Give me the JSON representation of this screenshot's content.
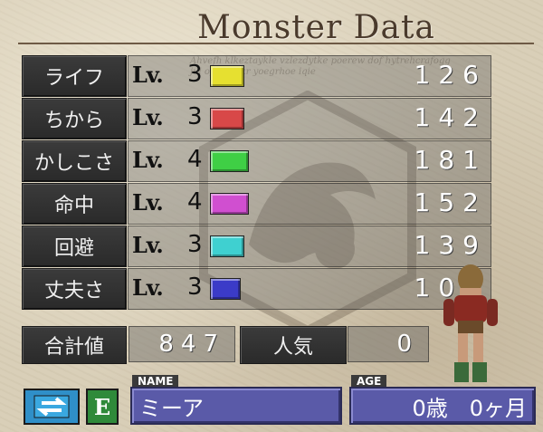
{
  "title": "Monster Data",
  "lv_prefix": "Lv.",
  "stats": [
    {
      "label": "ライフ",
      "level": "3",
      "color": "#e6e030",
      "value": "126",
      "bar_level": 0.33
    },
    {
      "label": "ちから",
      "level": "3",
      "color": "#d84848",
      "value": "142",
      "bar_level": 0.33
    },
    {
      "label": "かしこさ",
      "level": "4",
      "color": "#3fcf45",
      "value": "181",
      "bar_level": 0.5
    },
    {
      "label": "命中",
      "level": "4",
      "color": "#d04fd0",
      "value": "152",
      "bar_level": 0.5
    },
    {
      "label": "回避",
      "level": "3",
      "color": "#3fd0d0",
      "value": "139",
      "bar_level": 0.33
    },
    {
      "label": "丈夫さ",
      "level": "3",
      "color": "#3b3bc8",
      "value": "107",
      "bar_level": 0.2
    }
  ],
  "summary": {
    "total_label": "合計値",
    "total_value": "847",
    "popularity_label": "人気",
    "popularity_value": "0"
  },
  "name_tag": "NAME",
  "name_value": "ミーア",
  "age_tag": "AGE",
  "age_value": "0歳　0ヶ月",
  "e_button": "E",
  "background_script": "Ahvefh klkeztaykle vzlezdytke poerew dof hytrehcrafogg jul ofqqnrokr yoegrhoe iqie"
}
